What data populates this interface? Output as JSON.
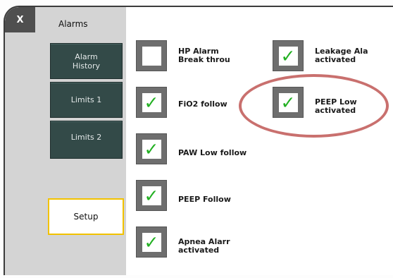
{
  "header": {
    "close_label": "X",
    "title": "Alarms"
  },
  "sidebar": {
    "alarm_history_line1": "Alarm",
    "alarm_history_line2": "History",
    "limits1": "Limits 1",
    "limits2": "Limits 2",
    "setup": "Setup"
  },
  "options": {
    "hp_alarm": {
      "line1": "HP Alarm",
      "line2": "Break throu",
      "checked": false
    },
    "fio2": {
      "line1": "FiO2 follow",
      "checked": true
    },
    "paw_low": {
      "line1": "PAW Low follow",
      "checked": true
    },
    "peep_follow": {
      "line1": "PEEP Follow",
      "checked": true
    },
    "apnea": {
      "line1": "Apnea Alarr",
      "line2": "activated",
      "checked": true
    },
    "leakage": {
      "line1": "Leakage Ala",
      "line2": "activated",
      "checked": true
    },
    "peep_low": {
      "line1": "PEEP Low",
      "line2": "activated",
      "checked": true
    }
  },
  "check_glyph": "✓",
  "colors": {
    "button_dark": "#334a48",
    "check": "#22b022",
    "highlight": "#c9706e",
    "setup_border": "#f2c200"
  }
}
